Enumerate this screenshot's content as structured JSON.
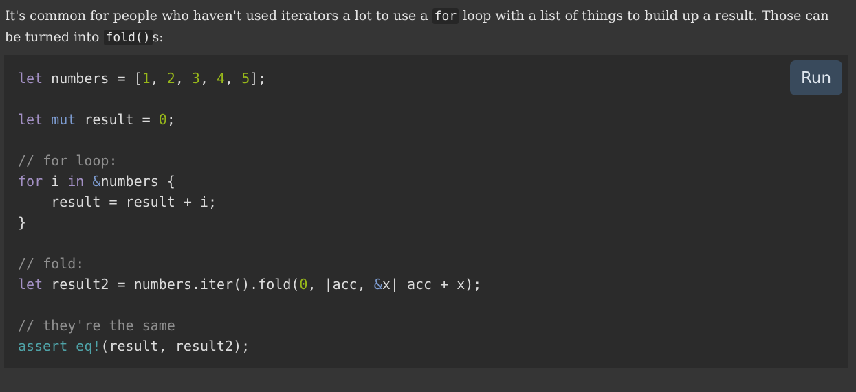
{
  "intro": {
    "part1": "It's common for people who haven't used iterators a lot to use a ",
    "code1": "for",
    "part2": " loop with a list of things to build up a result. Those can be turned into ",
    "code2": "fold()",
    "part3": "s:"
  },
  "run_button": {
    "label": "Run"
  },
  "code": {
    "l1": {
      "kw": "let",
      "a": " numbers = [",
      "n1": "1",
      "s1": ", ",
      "n2": "2",
      "s2": ", ",
      "n3": "3",
      "s3": ", ",
      "n4": "4",
      "s4": ", ",
      "n5": "5",
      "end": "];"
    },
    "l3": {
      "kw": "let",
      "sp": " ",
      "mut": "mut",
      "a": " result = ",
      "n": "0",
      "end": ";"
    },
    "l5": {
      "comment": "// for loop:"
    },
    "l6": {
      "kw1": "for",
      "a": " i ",
      "kw2": "in",
      "sp": " ",
      "amp": "&",
      "b": "numbers {"
    },
    "l7": {
      "text": "    result = result + i;"
    },
    "l8": {
      "text": "}"
    },
    "l10": {
      "comment": "// fold:"
    },
    "l11": {
      "kw": "let",
      "a": " result2 = numbers.iter().fold(",
      "n": "0",
      "b": ", |acc, ",
      "amp": "&",
      "c": "x| acc + x);"
    },
    "l13": {
      "comment": "// they're the same"
    },
    "l14": {
      "macro": "assert_eq!",
      "a": "(result, result2);"
    }
  },
  "colors": {
    "keyword": "#a390c4",
    "keyword_mut": "#7d9cd1",
    "number": "#98b81a",
    "comment": "#8f8f8f",
    "macro": "#4fa3a8",
    "run_button_bg": "#394a5c"
  }
}
